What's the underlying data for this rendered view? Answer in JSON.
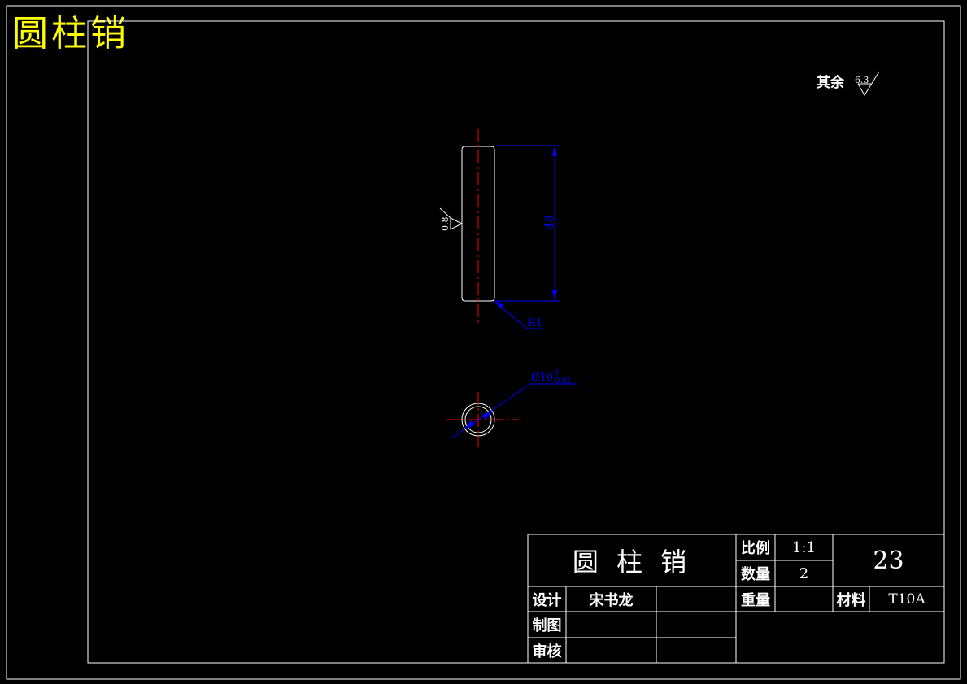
{
  "drawing_title": "圆柱销",
  "roughness_note": {
    "label": "其余",
    "value": "6.3"
  },
  "annotations": {
    "surface_roughness": "0.8",
    "length_dimension": "48",
    "radius_callout": "R1",
    "diameter_callout": "Ø10",
    "diameter_tol_upper": "0",
    "diameter_tol_lower": "-0.02"
  },
  "title_block": {
    "part_name": "圆 柱 销",
    "scale_label": "比例",
    "scale_value": "1:1",
    "quantity_label": "数量",
    "quantity_value": "2",
    "drawing_number": "23",
    "designer_label": "设计",
    "designer_name": "宋书龙",
    "weight_label": "重量",
    "weight_value": "",
    "material_label": "材料",
    "material_value": "T10A",
    "drafter_label": "制图",
    "checker_label": "审核"
  },
  "colors": {
    "background": "#000000",
    "title": "#ffff00",
    "outline": "#ffffff",
    "centerline": "#ff0000",
    "dimension": "#0000ff"
  }
}
